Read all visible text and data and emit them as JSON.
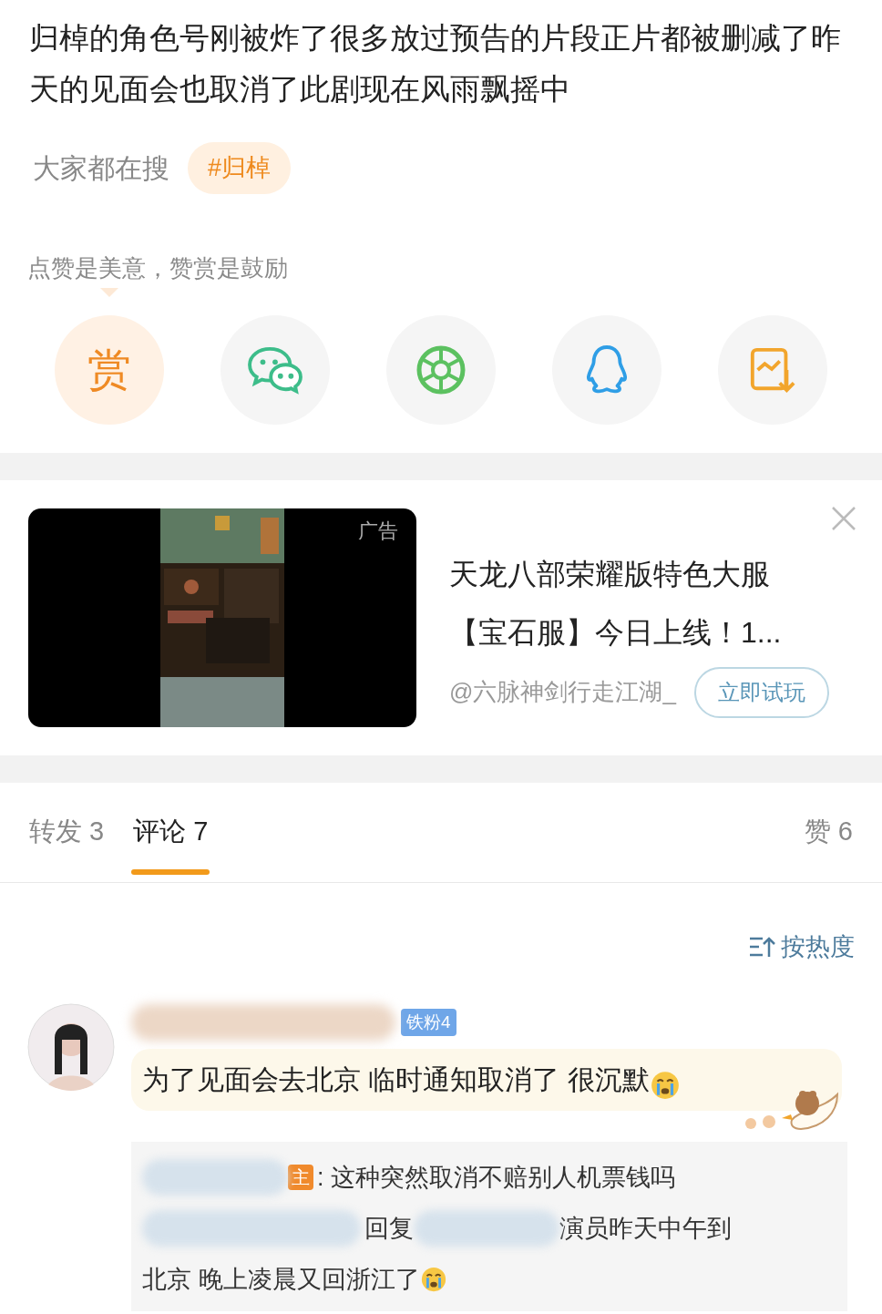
{
  "post": {
    "text": "归棹的角色号刚被炸了很多放过预告的片段正片都被删减了昨天的见面会也取消了此剧现在风雨飘摇中"
  },
  "trending": {
    "label": "大家都在搜",
    "tag": "#归棹"
  },
  "reward": {
    "hint": "点赞是美意，赞赏是鼓励",
    "reward_glyph": "赏"
  },
  "share_buttons": [
    {
      "kind": "reward"
    },
    {
      "kind": "wechat"
    },
    {
      "kind": "moments"
    },
    {
      "kind": "qq"
    },
    {
      "kind": "save-image"
    }
  ],
  "ad": {
    "badge": "广告",
    "title": "天龙八部荣耀版特色大服【宝石服】今日上线！1...",
    "author": "@六脉神剑行走江湖_",
    "button": "立即试玩"
  },
  "tabs": [
    {
      "label": "转发 3",
      "selected": false
    },
    {
      "label": "评论 7",
      "selected": true
    }
  ],
  "likes": "赞 6",
  "sort": "按热度",
  "comments": [
    {
      "fan_badge": "铁粉4",
      "text": "为了见面会去北京 临时通知取消了 很沉默",
      "replies": [
        {
          "kind": "reply",
          "author_badge": "主",
          "text": ": 这种突然取消不赔别人机票钱吗"
        },
        {
          "kind": "reply-to",
          "reply_word": "回复",
          "text": "演员昨天中午到",
          "text_continued": "北京 晚上凌晨又回浙江了"
        }
      ]
    }
  ]
}
